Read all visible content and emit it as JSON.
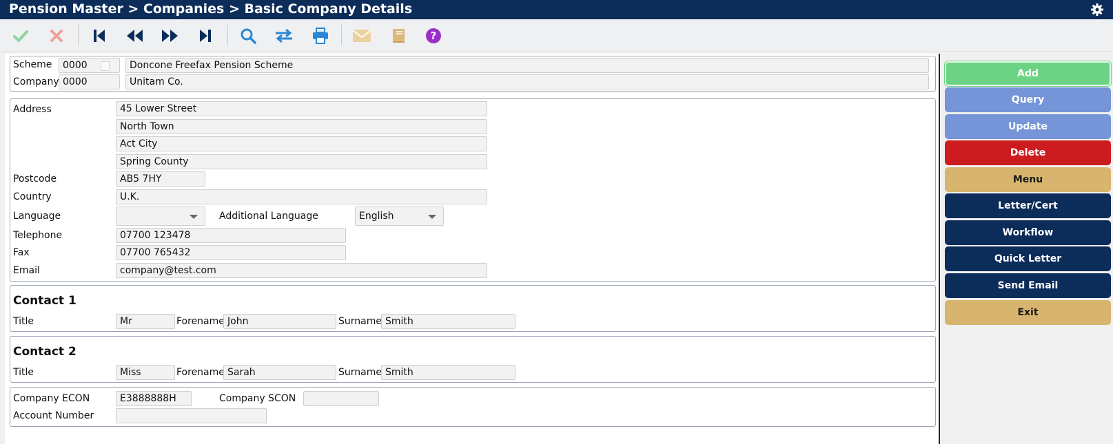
{
  "window": {
    "title": "Pension Master > Companies > Basic Company Details"
  },
  "toolbar": {
    "icons": [
      "check-icon",
      "cross-icon",
      "first-record-icon",
      "previous-record-icon",
      "next-record-icon",
      "last-record-icon",
      "search-icon",
      "swap-icon",
      "print-icon",
      "email-icon",
      "book-icon",
      "help-icon"
    ]
  },
  "header": {
    "scheme_label": "Scheme",
    "scheme_code": "0000",
    "scheme_name": "Doncone Freefax Pension Scheme",
    "company_label": "Company",
    "company_code": "0000",
    "company_name": "Unitam Co."
  },
  "address": {
    "address_label": "Address",
    "line1": "45 Lower Street",
    "line2": "North Town",
    "line3": "Act City",
    "line4": "Spring County",
    "postcode_label": "Postcode",
    "postcode": "AB5 7HY",
    "country_label": "Country",
    "country": "U.K.",
    "language_label": "Language",
    "language": "",
    "additional_language_label": "Additional Language",
    "additional_language": "English",
    "telephone_label": "Telephone",
    "telephone": "07700 123478",
    "fax_label": "Fax",
    "fax": "07700 765432",
    "email_label": "Email",
    "email": "company@test.com"
  },
  "contact1": {
    "heading": "Contact 1",
    "title_label": "Title",
    "title": "Mr",
    "forename_label": "Forename",
    "forename": "John",
    "surname_label": "Surname",
    "surname": "Smith"
  },
  "contact2": {
    "heading": "Contact 2",
    "title_label": "Title",
    "title": "Miss",
    "forename_label": "Forename",
    "forename": "Sarah",
    "surname_label": "Surname",
    "surname": "Smith"
  },
  "company_numbers": {
    "econ_label": "Company ECON",
    "econ": "E3888888H",
    "scon_label": "Company SCON",
    "scon": "",
    "account_label": "Account Number",
    "account": ""
  },
  "actions": {
    "add": "Add",
    "query": "Query",
    "update": "Update",
    "delete": "Delete",
    "menu": "Menu",
    "letter": "Letter/Cert",
    "workflow": "Workflow",
    "quick_letter": "Quick Letter",
    "send_email": "Send Email",
    "exit": "Exit"
  },
  "colors": {
    "titlebar": "#0c2c5a",
    "add": "#6dd384",
    "query": "#7595d8",
    "delete": "#cc1c1f",
    "tan": "#d8b56e",
    "navy": "#0c2c5a"
  }
}
